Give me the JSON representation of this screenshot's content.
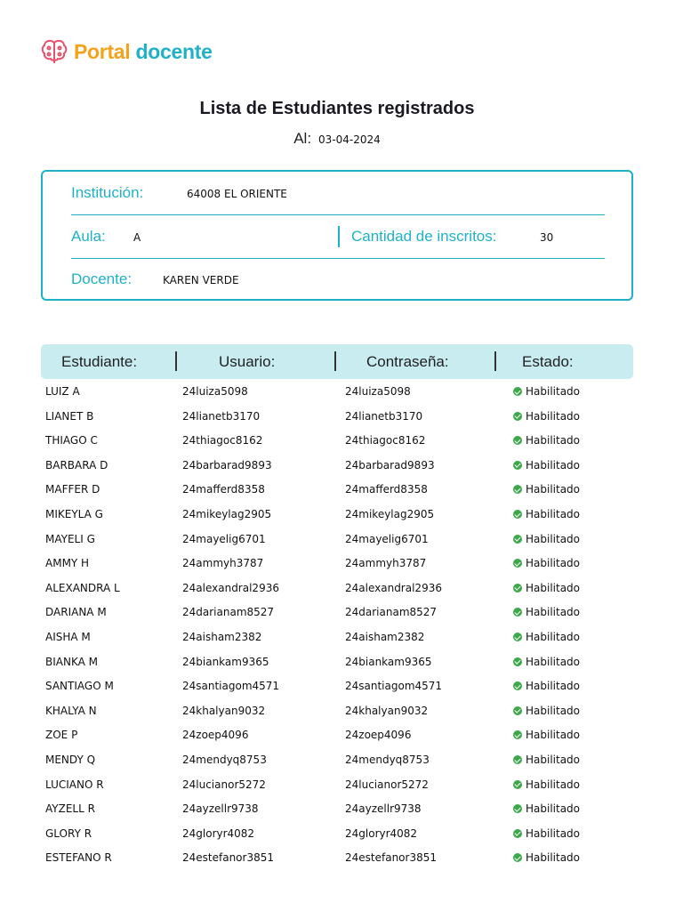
{
  "brand": {
    "part1": "Portal",
    "part2": "docente",
    "colors": {
      "orange": "#f5a21b",
      "teal": "#1fb1c6",
      "brain": "#e8506b"
    }
  },
  "title": "Lista de Estudiantes registrados",
  "date_label": "Al:",
  "date": "03-04-2024",
  "info": {
    "institucion_label": "Institución:",
    "institucion": "64008 EL ORIENTE",
    "aula_label": "Aula:",
    "aula": "A",
    "cantidad_label": "Cantidad de inscritos:",
    "cantidad": "30",
    "docente_label": "Docente:",
    "docente": "KAREN VERDE"
  },
  "table": {
    "headers": [
      "Estudiante:",
      "Usuario:",
      "Contraseña:",
      "Estado:"
    ],
    "rows": [
      [
        "LUIZ A",
        "24luiza5098",
        "24luiza5098",
        "Habilitado"
      ],
      [
        "LIANET B",
        "24lianetb3170",
        "24lianetb3170",
        "Habilitado"
      ],
      [
        "THIAGO C",
        "24thiagoc8162",
        "24thiagoc8162",
        "Habilitado"
      ],
      [
        "BARBARA D",
        "24barbarad9893",
        "24barbarad9893",
        "Habilitado"
      ],
      [
        "MAFFER D",
        "24mafferd8358",
        "24mafferd8358",
        "Habilitado"
      ],
      [
        "MIKEYLA G",
        "24mikeylag2905",
        "24mikeylag2905",
        "Habilitado"
      ],
      [
        "MAYELI G",
        "24mayelig6701",
        "24mayelig6701",
        "Habilitado"
      ],
      [
        "AMMY H",
        "24ammyh3787",
        "24ammyh3787",
        "Habilitado"
      ],
      [
        "ALEXANDRA L",
        "24alexandral2936",
        "24alexandral2936",
        "Habilitado"
      ],
      [
        "DARIANA M",
        "24darianam8527",
        "24darianam8527",
        "Habilitado"
      ],
      [
        "AISHA M",
        "24aisham2382",
        "24aisham2382",
        "Habilitado"
      ],
      [
        "BIANKA M",
        "24biankam9365",
        "24biankam9365",
        "Habilitado"
      ],
      [
        "SANTIAGO M",
        "24santiagom4571",
        "24santiagom4571",
        "Habilitado"
      ],
      [
        "KHALYA N",
        "24khalyan9032",
        "24khalyan9032",
        "Habilitado"
      ],
      [
        "ZOE P",
        "24zoep4096",
        "24zoep4096",
        "Habilitado"
      ],
      [
        "MENDY Q",
        "24mendyq8753",
        "24mendyq8753",
        "Habilitado"
      ],
      [
        "LUCIANO R",
        "24lucianor5272",
        "24lucianor5272",
        "Habilitado"
      ],
      [
        "AYZELL R",
        "24ayzellr9738",
        "24ayzellr9738",
        "Habilitado"
      ],
      [
        "GLORY R",
        "24gloryr4082",
        "24gloryr4082",
        "Habilitado"
      ],
      [
        "ESTEFANO R",
        "24estefanor3851",
        "24estefanor3851",
        "Habilitado"
      ]
    ]
  }
}
